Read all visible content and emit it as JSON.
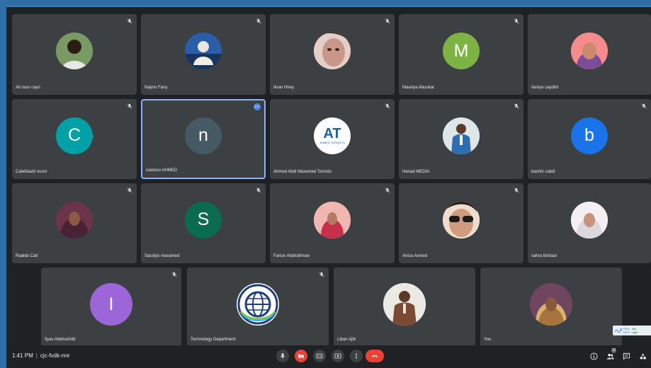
{
  "participants_row1": [
    {
      "name": "Ali nuur cayn",
      "avatar": "photo-man-green-bg"
    },
    {
      "name": "Najmo Fany",
      "avatar": "photo-woman-blue-bg"
    },
    {
      "name": "Ikran Hirey",
      "avatar": "photo-woman-closeup"
    },
    {
      "name": "Maariya Abuukar",
      "avatar": "letter",
      "letter": "M",
      "color": "#7cb342"
    },
    {
      "name": "farxiyo caydiid",
      "avatar": "photo-woman-pink"
    }
  ],
  "participants_row2": [
    {
      "name": "Cabdilaahi xusni",
      "avatar": "letter",
      "letter": "C",
      "color": "#00a0a8"
    },
    {
      "name": "nastexo AHMED",
      "avatar": "letter",
      "letter": "n",
      "color": "#455a64"
    },
    {
      "name": "Ahmed Abdi Maxamed Toronto",
      "avatar": "logo-at",
      "logo_text": "AT",
      "logo_sub": "AHMED TORONTO"
    },
    {
      "name": "Hanad MEDIA",
      "avatar": "photo-man-suit"
    },
    {
      "name": "bashiir cabdi",
      "avatar": "letter",
      "letter": "b",
      "color": "#1a73e8"
    }
  ],
  "participants_row3": [
    {
      "name": "Raaldo Cali",
      "avatar": "photo-woman-hijab-purple"
    },
    {
      "name": "Sacdiyo maxamed",
      "avatar": "letter",
      "letter": "S",
      "color": "#0b6b50"
    },
    {
      "name": "Fartun Abdirahman",
      "avatar": "photo-woman-red"
    },
    {
      "name": "Anisa Axmed",
      "avatar": "photo-woman-sunglasses"
    },
    {
      "name": "sahra bishaar",
      "avatar": "photo-woman-hijab-white"
    }
  ],
  "participants_row4": [
    {
      "name": "Ilyas Abdirashiid",
      "avatar": "letter",
      "letter": "I",
      "color": "#9c65d8"
    },
    {
      "name": "Technology Department",
      "avatar": "logo-globe"
    },
    {
      "name": "Liban Ajib",
      "avatar": "photo-man-jacket"
    },
    {
      "name": "You",
      "avatar": "photo-woman-hijab-floral"
    }
  ],
  "bottombar": {
    "time": "1:41 PM",
    "separator": "|",
    "meeting_code": "cjc-fvdk-nre",
    "participant_count": "22"
  },
  "perf_overlay": {
    "cpu_label": "CPU",
    "gpu_label": "GPU",
    "cpu_value": "Idle",
    "gpu_value": "Light"
  },
  "colors": {
    "background": "#202124",
    "tile": "#3c4043",
    "active_border": "#8ab4f8",
    "hangup": "#ea4335"
  }
}
